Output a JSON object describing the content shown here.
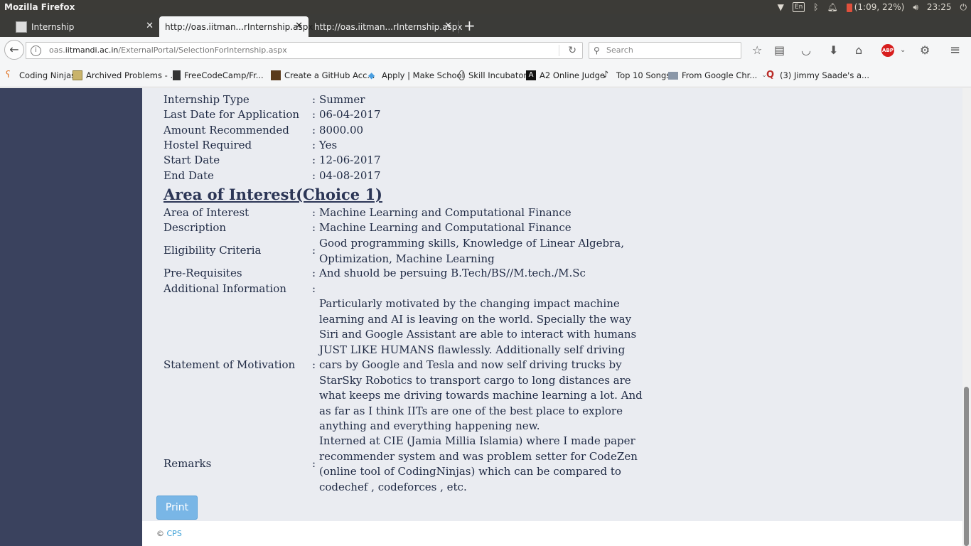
{
  "os": {
    "app_name": "Mozilla Firefox",
    "keyboard": "En",
    "battery": "(1:09, 22%)",
    "time": "23:25"
  },
  "tabs": [
    {
      "label": "Internship"
    },
    {
      "label": "http://oas.iitman...rInternship.aspx"
    },
    {
      "label": "http://oas.iitman...rInternship.aspx"
    }
  ],
  "url": {
    "prefix": "oas.",
    "domain": "iitmandi.ac.in",
    "path": "/ExternalPortal/SelectionForInternship.aspx"
  },
  "search": {
    "placeholder": "Search"
  },
  "toolbar": {
    "abp_label": "ABP"
  },
  "bookmarks": [
    {
      "label": "Coding Ninjas"
    },
    {
      "label": "Archived Problems - ..."
    },
    {
      "label": "FreeCodeCamp/Fr..."
    },
    {
      "label": "Create a GitHub Acc..."
    },
    {
      "label": "Apply | Make School"
    },
    {
      "label": "Skill Incubator"
    },
    {
      "label": "A2 Online Judge"
    },
    {
      "label": "Top 10 Songs"
    },
    {
      "label": "From Google Chr..."
    },
    {
      "label": "(3) Jimmy Saade's a..."
    }
  ],
  "details": [
    {
      "label": "Internship Type",
      "value": "Summer"
    },
    {
      "label": "Last Date for Application",
      "value": "06-04-2017"
    },
    {
      "label": "Amount Recommended",
      "value": "8000.00"
    },
    {
      "label": "Hostel Required",
      "value": "Yes"
    },
    {
      "label": "Start Date",
      "value": "12-06-2017"
    },
    {
      "label": "End Date",
      "value": "04-08-2017"
    }
  ],
  "section": {
    "heading": "Area of Interest(Choice 1)"
  },
  "interest": [
    {
      "label": "Area of Interest",
      "value": "Machine Learning and Computational Finance"
    },
    {
      "label": "Description",
      "value": "Machine Learning and Computational Finance"
    },
    {
      "label": "Eligibility Criteria",
      "value": "Good programming skills, Knowledge of Linear Algebra, Optimization, Machine Learning"
    },
    {
      "label": "Pre-Requisites",
      "value": "And shuold be persuing B.Tech/BS//M.tech./M.Sc"
    },
    {
      "label": "Additional Information",
      "value": ""
    },
    {
      "label": "Statement of Motivation",
      "value": "Particularly motivated by the changing impact machine learning and AI is leaving on the world. Specially the way Siri and Google Assistant are able to interact with humans JUST LIKE HUMANS flawlessly. Additionally self driving cars by Google and Tesla and now self driving trucks by StarSky Robotics to transport cargo to long distances are what keeps me driving towards machine learning a lot. And as far as I think IITs are one of the best place to explore anything and everything happening new."
    },
    {
      "label": "Remarks",
      "value": "Interned at CIE (Jamia Millia Islamia) where I made paper recommender system and was problem setter for CodeZen (online tool of CodingNinjas) which can be compared to codechef , codeforces , etc."
    }
  ],
  "colon": ":",
  "print_label": "Print",
  "footer": {
    "copyright": "©",
    "brand": "CPS"
  }
}
